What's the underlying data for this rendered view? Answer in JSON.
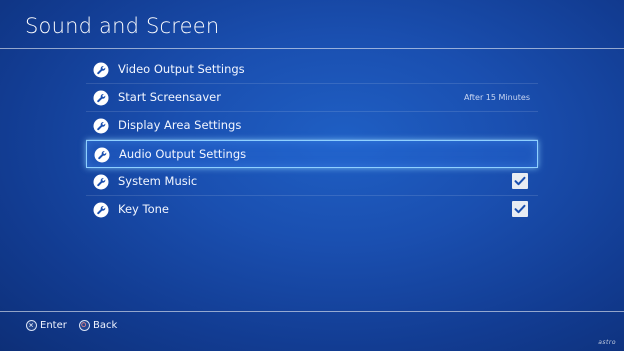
{
  "header": {
    "title": "Sound and Screen"
  },
  "menu": {
    "items": [
      {
        "label": "Video Output Settings",
        "icon": "wrench-icon"
      },
      {
        "label": "Start Screensaver",
        "icon": "wrench-icon",
        "value": "After 15 Minutes"
      },
      {
        "label": "Display Area Settings",
        "icon": "wrench-icon"
      },
      {
        "label": "Audio Output Settings",
        "icon": "wrench-icon",
        "selected": true
      },
      {
        "label": "System Music",
        "icon": "wrench-icon",
        "checked": true
      },
      {
        "label": "Key Tone",
        "icon": "wrench-icon",
        "checked": true
      }
    ]
  },
  "footer": {
    "enter_label": "Enter",
    "enter_icon": "cross-button-icon",
    "back_label": "Back",
    "back_icon": "circle-button-icon"
  },
  "watermark": "astro",
  "colors": {
    "background": "#1a4fb0",
    "selection_border": "#8fd0ff",
    "checkbox_fill": "#e8ecf3",
    "checkmark": "#1a4fb0"
  }
}
